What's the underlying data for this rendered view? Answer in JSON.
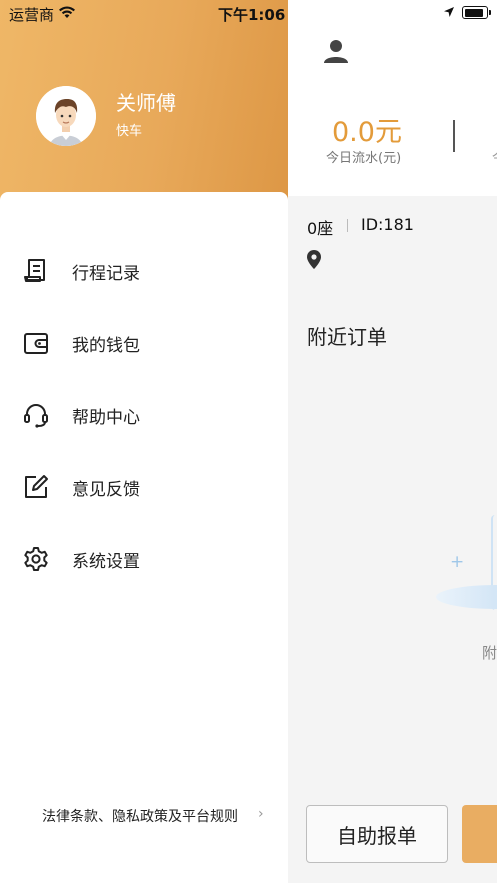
{
  "status_bar": {
    "carrier": "运营商",
    "time": "下午1:06"
  },
  "drawer": {
    "driver_name": "关师傅",
    "driver_type": "快车",
    "menu": [
      {
        "label": "行程记录",
        "icon": "trip-record-icon"
      },
      {
        "label": "我的钱包",
        "icon": "wallet-icon"
      },
      {
        "label": "帮助中心",
        "icon": "headset-icon"
      },
      {
        "label": "意见反馈",
        "icon": "feedback-edit-icon"
      },
      {
        "label": "系统设置",
        "icon": "gear-icon"
      }
    ],
    "legal_link": "法律条款、隐私政策及平台规则"
  },
  "main": {
    "earnings_value": "0.0元",
    "earnings_label": "今日流水(元)",
    "partial_stat_label": "今",
    "seats": "0座",
    "driver_id": "ID:181",
    "nearby_title": "附近订单",
    "empty_partial": "附",
    "self_report_button": "自助报单"
  },
  "colors": {
    "accent": "#e39b3a",
    "drawer_header_start": "#efb767",
    "drawer_header_end": "#dd9745"
  }
}
